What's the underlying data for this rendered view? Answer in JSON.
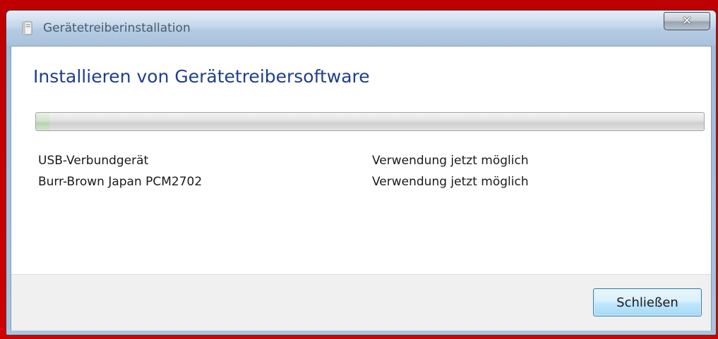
{
  "window": {
    "title": "Gerätetreiberinstallation",
    "close_icon": "close-icon",
    "app_icon": "device-installer-icon"
  },
  "main": {
    "heading": "Installieren von Gerätetreibersoftware",
    "progress": 0.02,
    "devices": [
      {
        "name": "USB-Verbundgerät",
        "status": "Verwendung jetzt möglich"
      },
      {
        "name": "Burr-Brown Japan PCM2702",
        "status": "Verwendung jetzt möglich"
      }
    ]
  },
  "footer": {
    "close_label": "Schließen"
  },
  "colors": {
    "heading": "#1e3f8a",
    "accent_border": "#c00000",
    "button_border": "#3c7fb1"
  }
}
